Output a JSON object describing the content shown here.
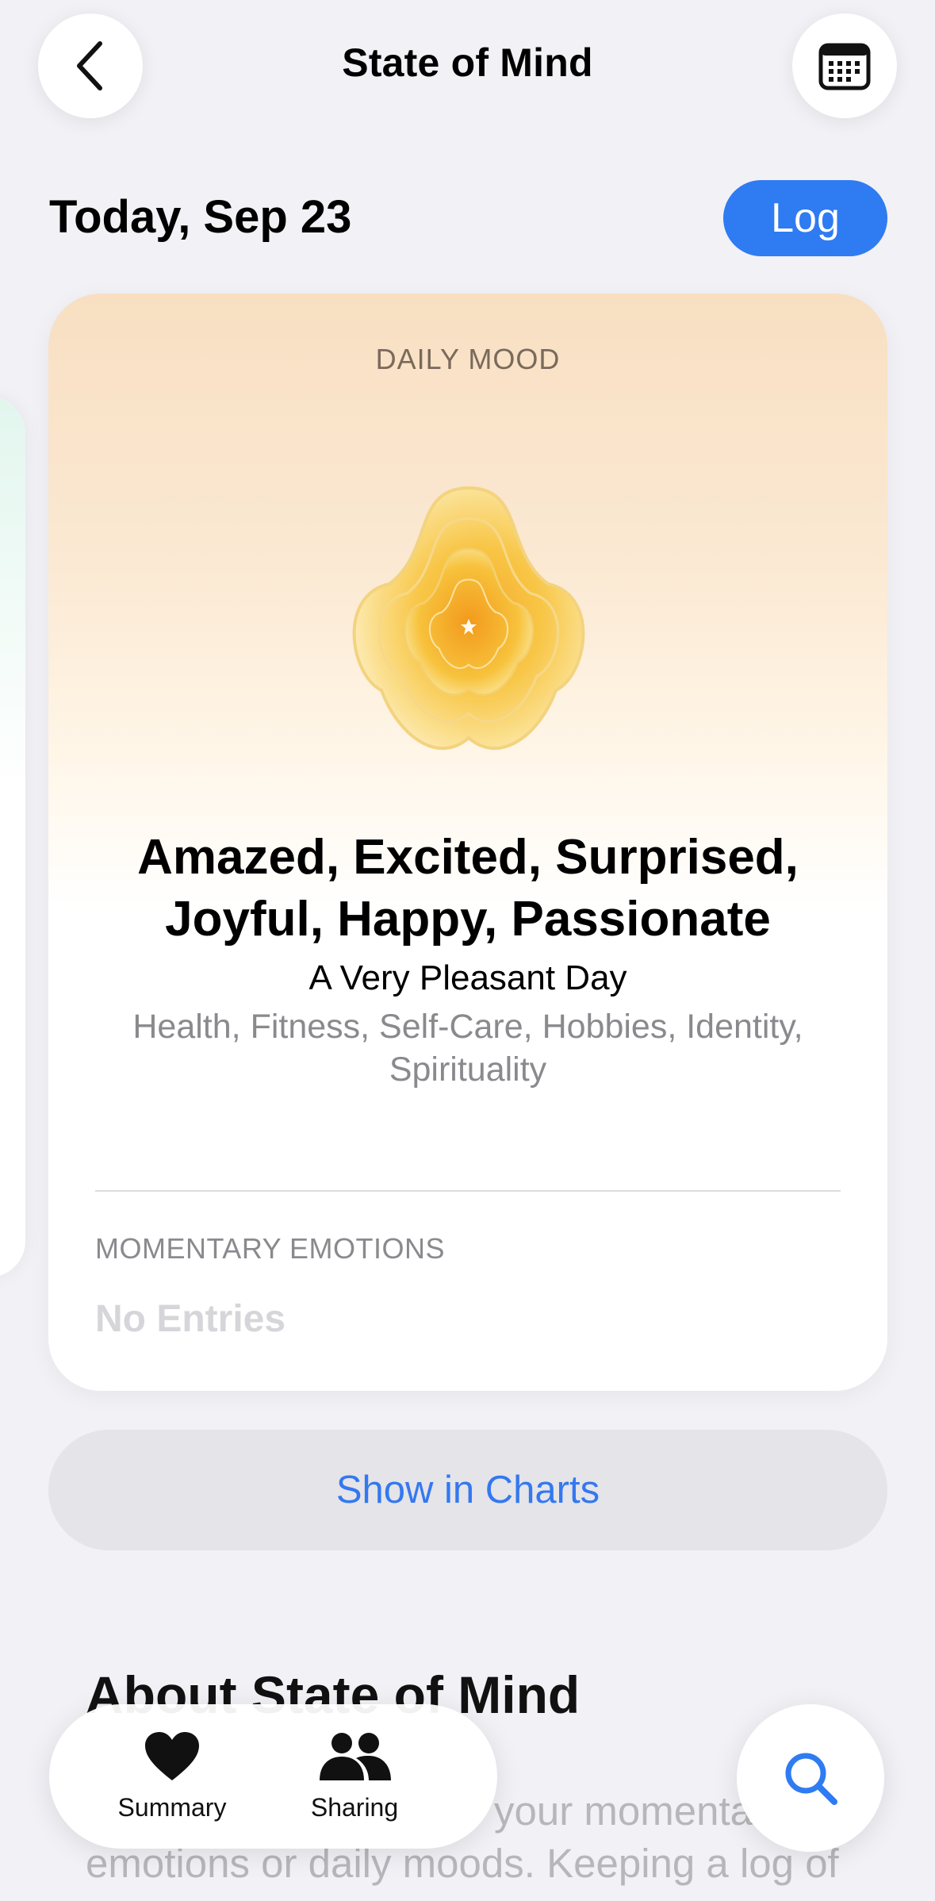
{
  "nav": {
    "title": "State of Mind",
    "back_icon": "chevron-left-icon",
    "calendar_icon": "calendar-icon"
  },
  "header": {
    "date": "Today, Sep 23",
    "log_label": "Log"
  },
  "daily_mood_card": {
    "label": "DAILY MOOD",
    "emotions": [
      "Amazed, Excited, Surprised,",
      "Joyful, Happy, Passionate"
    ],
    "valence": "A Very Pleasant Day",
    "associations": [
      "Health, Fitness, Self-Care, Hobbies, Identity,",
      "Spirituality"
    ],
    "momentary_label": "MOMENTARY EMOTIONS",
    "momentary_value": "No Entries",
    "accent_color": "#f5c34a"
  },
  "charts_button": {
    "label": "Show in Charts",
    "color": "#3478f0"
  },
  "about": {
    "title": "About State of Mind",
    "body_line1": "your momenta",
    "body_line2": "emotions or daily moods. Keeping a log of"
  },
  "tabbar": {
    "summary_label": "Summary",
    "summary_icon": "heart-icon",
    "sharing_label": "Sharing",
    "sharing_icon": "people-icon",
    "search_icon": "search-icon"
  },
  "colors": {
    "log_button": "#2f7bf2",
    "background": "#f1f1f6"
  }
}
